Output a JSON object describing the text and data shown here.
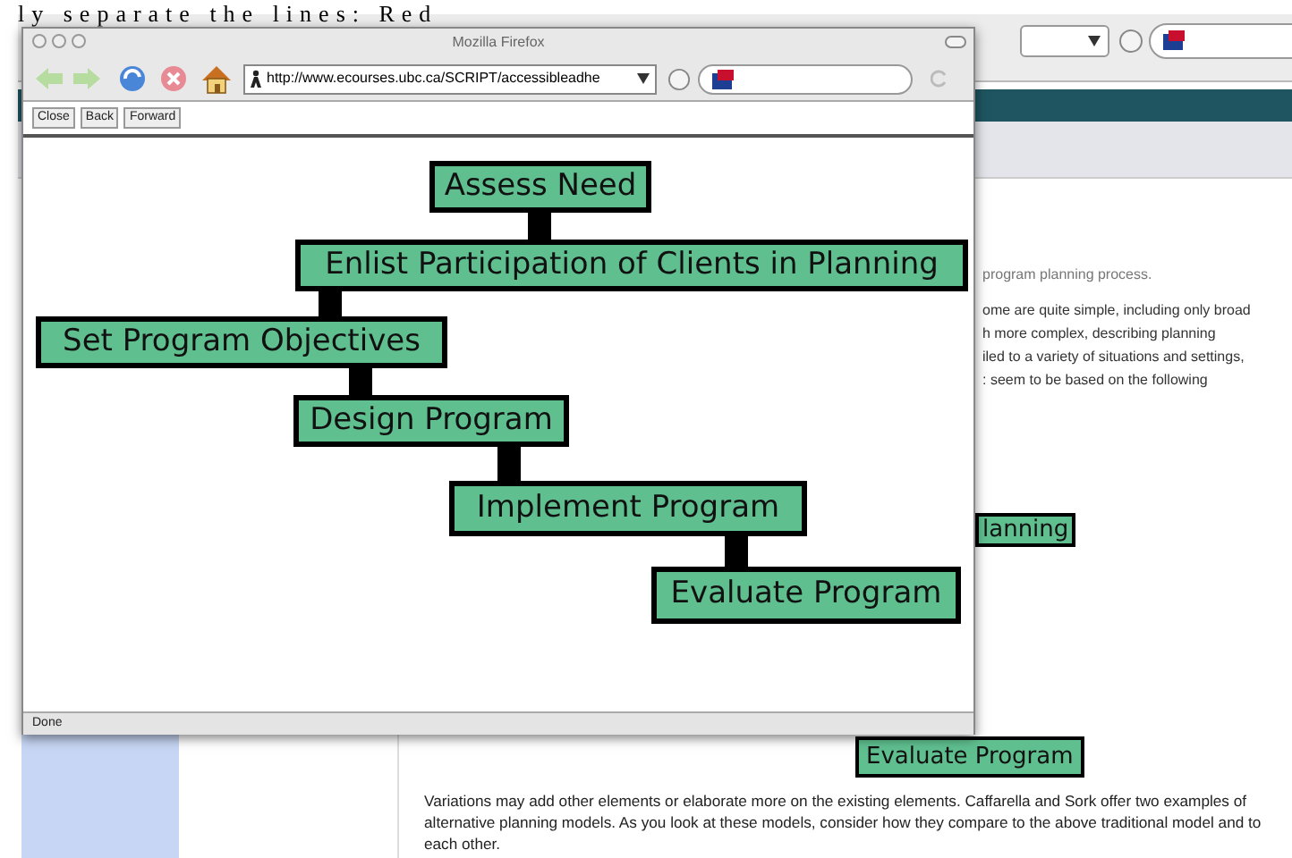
{
  "document_text": "ly separate the lines: Red",
  "background_window": {
    "page_lines": [
      "program planning process.",
      "ome are quite simple, including only broad",
      "h more complex, describing planning",
      "iled to a variety of situations and settings,",
      ": seem to be based on the following"
    ],
    "diagram_fragments": [
      "lanning",
      "Evaluate Program"
    ],
    "paragraph": "Variations may add other elements or elaborate more on the existing elements. Caffarella and Sork offer two examples of alternative planning models. As you look at these models, consider how they compare to the above traditional model and to each other."
  },
  "window": {
    "title": "Mozilla Firefox",
    "url": "http://www.ecourses.ubc.ca/SCRIPT/accessibleadhe",
    "buttons": [
      "Close",
      "Back",
      "Forward"
    ],
    "status": "Done"
  },
  "flowchart": {
    "steps": [
      "Assess Need",
      "Enlist Participation of Clients in Planning",
      "Set Program Objectives",
      "Design Program",
      "Implement Program",
      "Evaluate Program"
    ]
  }
}
